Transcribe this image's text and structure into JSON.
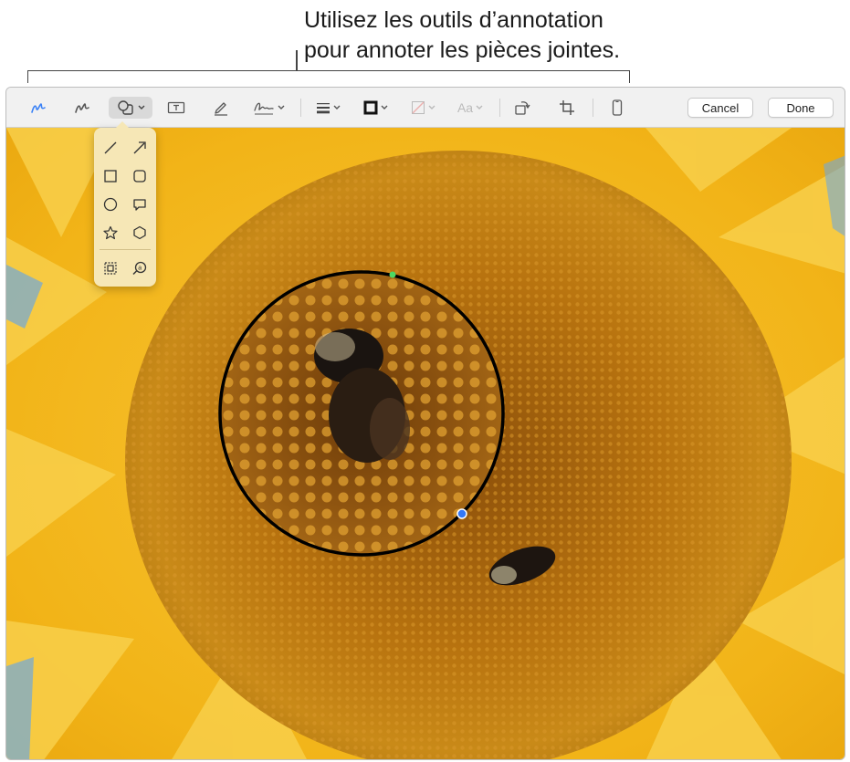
{
  "callout": {
    "line1": "Utilisez les outils d’annotation",
    "line2": "pour annoter les pièces jointes."
  },
  "toolbar": {
    "tools": [
      {
        "id": "sketch",
        "icon": "sketch-icon"
      },
      {
        "id": "draw",
        "icon": "draw-icon"
      },
      {
        "id": "shapes",
        "icon": "shapes-icon",
        "active": true,
        "has_menu": true
      },
      {
        "id": "text",
        "icon": "text-box-icon"
      },
      {
        "id": "highlight",
        "icon": "highlighter-icon"
      },
      {
        "id": "sign",
        "icon": "signature-icon",
        "has_menu": true
      },
      {
        "id": "shape-style",
        "icon": "line-weight-icon",
        "has_menu": true
      },
      {
        "id": "border-color",
        "icon": "border-color-icon",
        "has_menu": true
      },
      {
        "id": "fill-color",
        "icon": "fill-color-icon",
        "has_menu": true,
        "disabled": true
      },
      {
        "id": "text-style",
        "icon": "text-style-icon",
        "label": "Aa",
        "has_menu": true,
        "disabled": true
      },
      {
        "id": "rotate",
        "icon": "rotate-icon"
      },
      {
        "id": "crop",
        "icon": "crop-icon"
      },
      {
        "id": "device",
        "icon": "iphone-icon"
      }
    ],
    "cancel_label": "Cancel",
    "done_label": "Done"
  },
  "shapes_menu": {
    "items": [
      "line",
      "arrow",
      "rectangle",
      "rounded-rectangle",
      "oval",
      "speech-bubble",
      "star",
      "polygon",
      "mask",
      "loupe"
    ]
  },
  "colors": {
    "accent": "#3b82f6",
    "popover_bg": "#f6e7b6",
    "handle_green": "#4cd964",
    "handle_blue": "#3478f6"
  }
}
